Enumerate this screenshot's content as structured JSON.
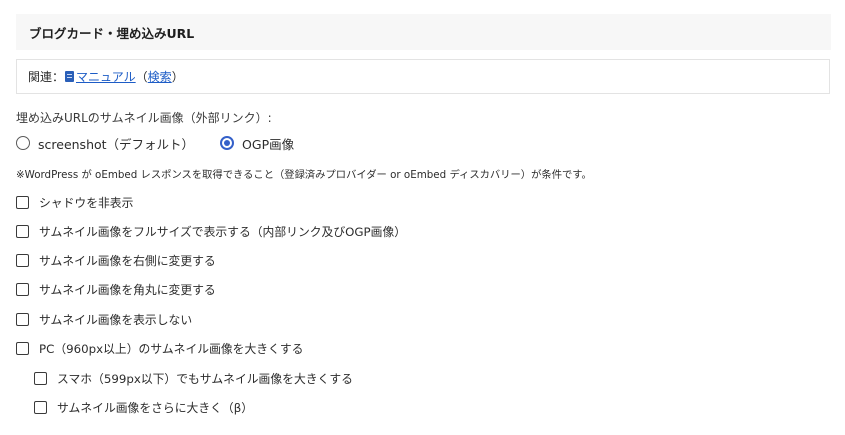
{
  "section": {
    "title": "ブログカード・埋め込みURL"
  },
  "related": {
    "prefix": "関連：",
    "link_label": "マニュアル",
    "paren_open": "（",
    "search_label": "検索",
    "paren_close": "）"
  },
  "thumbnail": {
    "label": "埋め込みURLのサムネイル画像（外部リンク）:",
    "options": [
      {
        "label": "screenshot（デフォルト）",
        "checked": false
      },
      {
        "label": "OGP画像",
        "checked": true
      }
    ],
    "note": "※WordPress が oEmbed レスポンスを取得できること（登録済みプロバイダー or oEmbed ディスカバリー）が条件です。"
  },
  "checkboxes": [
    {
      "label": "シャドウを非表示",
      "checked": false
    },
    {
      "label": "サムネイル画像をフルサイズで表示する（内部リンク及びOGP画像）",
      "checked": false
    },
    {
      "label": "サムネイル画像を右側に変更する",
      "checked": false
    },
    {
      "label": "サムネイル画像を角丸に変更する",
      "checked": false
    },
    {
      "label": "サムネイル画像を表示しない",
      "checked": false
    },
    {
      "label": "PC（960px以上）のサムネイル画像を大きくする",
      "checked": false
    },
    {
      "label": "スマホ（599px以下）でもサムネイル画像を大きくする",
      "checked": false
    },
    {
      "label": "サムネイル画像をさらに大きく（β）",
      "checked": false
    }
  ],
  "colors": {
    "accent": "#3460c9",
    "link": "#1d5cc6",
    "header_bg": "#f7f7f7"
  }
}
